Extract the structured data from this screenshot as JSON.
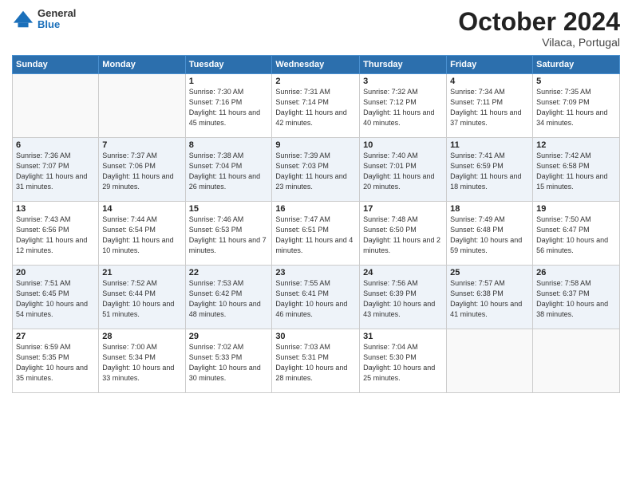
{
  "header": {
    "logo": {
      "general": "General",
      "blue": "Blue"
    },
    "title": "October 2024",
    "subtitle": "Vilaca, Portugal"
  },
  "days_of_week": [
    "Sunday",
    "Monday",
    "Tuesday",
    "Wednesday",
    "Thursday",
    "Friday",
    "Saturday"
  ],
  "weeks": [
    [
      {
        "day": "",
        "sunrise": "",
        "sunset": "",
        "daylight": ""
      },
      {
        "day": "",
        "sunrise": "",
        "sunset": "",
        "daylight": ""
      },
      {
        "day": "1",
        "sunrise": "Sunrise: 7:30 AM",
        "sunset": "Sunset: 7:16 PM",
        "daylight": "Daylight: 11 hours and 45 minutes."
      },
      {
        "day": "2",
        "sunrise": "Sunrise: 7:31 AM",
        "sunset": "Sunset: 7:14 PM",
        "daylight": "Daylight: 11 hours and 42 minutes."
      },
      {
        "day": "3",
        "sunrise": "Sunrise: 7:32 AM",
        "sunset": "Sunset: 7:12 PM",
        "daylight": "Daylight: 11 hours and 40 minutes."
      },
      {
        "day": "4",
        "sunrise": "Sunrise: 7:34 AM",
        "sunset": "Sunset: 7:11 PM",
        "daylight": "Daylight: 11 hours and 37 minutes."
      },
      {
        "day": "5",
        "sunrise": "Sunrise: 7:35 AM",
        "sunset": "Sunset: 7:09 PM",
        "daylight": "Daylight: 11 hours and 34 minutes."
      }
    ],
    [
      {
        "day": "6",
        "sunrise": "Sunrise: 7:36 AM",
        "sunset": "Sunset: 7:07 PM",
        "daylight": "Daylight: 11 hours and 31 minutes."
      },
      {
        "day": "7",
        "sunrise": "Sunrise: 7:37 AM",
        "sunset": "Sunset: 7:06 PM",
        "daylight": "Daylight: 11 hours and 29 minutes."
      },
      {
        "day": "8",
        "sunrise": "Sunrise: 7:38 AM",
        "sunset": "Sunset: 7:04 PM",
        "daylight": "Daylight: 11 hours and 26 minutes."
      },
      {
        "day": "9",
        "sunrise": "Sunrise: 7:39 AM",
        "sunset": "Sunset: 7:03 PM",
        "daylight": "Daylight: 11 hours and 23 minutes."
      },
      {
        "day": "10",
        "sunrise": "Sunrise: 7:40 AM",
        "sunset": "Sunset: 7:01 PM",
        "daylight": "Daylight: 11 hours and 20 minutes."
      },
      {
        "day": "11",
        "sunrise": "Sunrise: 7:41 AM",
        "sunset": "Sunset: 6:59 PM",
        "daylight": "Daylight: 11 hours and 18 minutes."
      },
      {
        "day": "12",
        "sunrise": "Sunrise: 7:42 AM",
        "sunset": "Sunset: 6:58 PM",
        "daylight": "Daylight: 11 hours and 15 minutes."
      }
    ],
    [
      {
        "day": "13",
        "sunrise": "Sunrise: 7:43 AM",
        "sunset": "Sunset: 6:56 PM",
        "daylight": "Daylight: 11 hours and 12 minutes."
      },
      {
        "day": "14",
        "sunrise": "Sunrise: 7:44 AM",
        "sunset": "Sunset: 6:54 PM",
        "daylight": "Daylight: 11 hours and 10 minutes."
      },
      {
        "day": "15",
        "sunrise": "Sunrise: 7:46 AM",
        "sunset": "Sunset: 6:53 PM",
        "daylight": "Daylight: 11 hours and 7 minutes."
      },
      {
        "day": "16",
        "sunrise": "Sunrise: 7:47 AM",
        "sunset": "Sunset: 6:51 PM",
        "daylight": "Daylight: 11 hours and 4 minutes."
      },
      {
        "day": "17",
        "sunrise": "Sunrise: 7:48 AM",
        "sunset": "Sunset: 6:50 PM",
        "daylight": "Daylight: 11 hours and 2 minutes."
      },
      {
        "day": "18",
        "sunrise": "Sunrise: 7:49 AM",
        "sunset": "Sunset: 6:48 PM",
        "daylight": "Daylight: 10 hours and 59 minutes."
      },
      {
        "day": "19",
        "sunrise": "Sunrise: 7:50 AM",
        "sunset": "Sunset: 6:47 PM",
        "daylight": "Daylight: 10 hours and 56 minutes."
      }
    ],
    [
      {
        "day": "20",
        "sunrise": "Sunrise: 7:51 AM",
        "sunset": "Sunset: 6:45 PM",
        "daylight": "Daylight: 10 hours and 54 minutes."
      },
      {
        "day": "21",
        "sunrise": "Sunrise: 7:52 AM",
        "sunset": "Sunset: 6:44 PM",
        "daylight": "Daylight: 10 hours and 51 minutes."
      },
      {
        "day": "22",
        "sunrise": "Sunrise: 7:53 AM",
        "sunset": "Sunset: 6:42 PM",
        "daylight": "Daylight: 10 hours and 48 minutes."
      },
      {
        "day": "23",
        "sunrise": "Sunrise: 7:55 AM",
        "sunset": "Sunset: 6:41 PM",
        "daylight": "Daylight: 10 hours and 46 minutes."
      },
      {
        "day": "24",
        "sunrise": "Sunrise: 7:56 AM",
        "sunset": "Sunset: 6:39 PM",
        "daylight": "Daylight: 10 hours and 43 minutes."
      },
      {
        "day": "25",
        "sunrise": "Sunrise: 7:57 AM",
        "sunset": "Sunset: 6:38 PM",
        "daylight": "Daylight: 10 hours and 41 minutes."
      },
      {
        "day": "26",
        "sunrise": "Sunrise: 7:58 AM",
        "sunset": "Sunset: 6:37 PM",
        "daylight": "Daylight: 10 hours and 38 minutes."
      }
    ],
    [
      {
        "day": "27",
        "sunrise": "Sunrise: 6:59 AM",
        "sunset": "Sunset: 5:35 PM",
        "daylight": "Daylight: 10 hours and 35 minutes."
      },
      {
        "day": "28",
        "sunrise": "Sunrise: 7:00 AM",
        "sunset": "Sunset: 5:34 PM",
        "daylight": "Daylight: 10 hours and 33 minutes."
      },
      {
        "day": "29",
        "sunrise": "Sunrise: 7:02 AM",
        "sunset": "Sunset: 5:33 PM",
        "daylight": "Daylight: 10 hours and 30 minutes."
      },
      {
        "day": "30",
        "sunrise": "Sunrise: 7:03 AM",
        "sunset": "Sunset: 5:31 PM",
        "daylight": "Daylight: 10 hours and 28 minutes."
      },
      {
        "day": "31",
        "sunrise": "Sunrise: 7:04 AM",
        "sunset": "Sunset: 5:30 PM",
        "daylight": "Daylight: 10 hours and 25 minutes."
      },
      {
        "day": "",
        "sunrise": "",
        "sunset": "",
        "daylight": ""
      },
      {
        "day": "",
        "sunrise": "",
        "sunset": "",
        "daylight": ""
      }
    ]
  ]
}
